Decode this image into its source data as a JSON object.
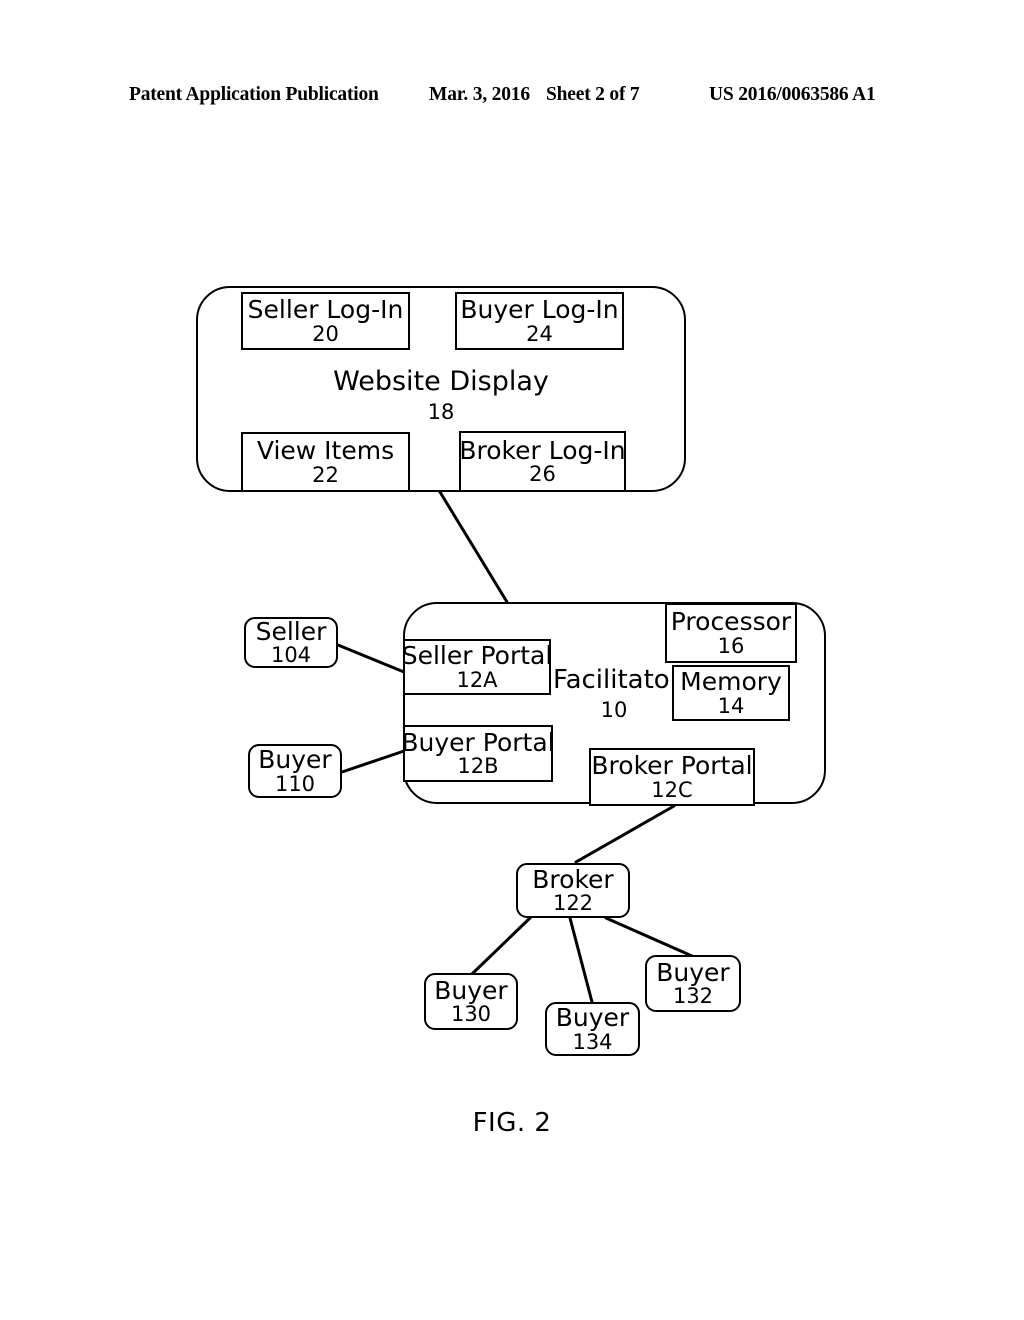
{
  "header": {
    "publication": "Patent Application Publication",
    "date": "Mar. 3, 2016",
    "sheet": "Sheet 2 of 7",
    "patent_number": "US 2016/0063586 A1"
  },
  "figure": {
    "caption": "FIG. 2",
    "website_display": {
      "label": "Website Display",
      "ref": "18",
      "children": [
        {
          "label": "Seller Log-In",
          "ref": "20"
        },
        {
          "label": "Buyer Log-In",
          "ref": "24"
        },
        {
          "label": "View Items",
          "ref": "22"
        },
        {
          "label": "Broker Log-In",
          "ref": "26"
        }
      ]
    },
    "facilitator": {
      "label": "Facilitator",
      "ref": "10",
      "children": [
        {
          "label": "Seller Portal",
          "ref": "12A"
        },
        {
          "label": "Buyer Portal",
          "ref": "12B"
        },
        {
          "label": "Broker Portal",
          "ref": "12C"
        },
        {
          "label": "Processor",
          "ref": "16"
        },
        {
          "label": "Memory",
          "ref": "14"
        }
      ]
    },
    "actors": [
      {
        "label": "Seller",
        "ref": "104"
      },
      {
        "label": "Buyer",
        "ref": "110"
      },
      {
        "label": "Broker",
        "ref": "122"
      },
      {
        "label": "Buyer",
        "ref": "130"
      },
      {
        "label": "Buyer",
        "ref": "132"
      },
      {
        "label": "Buyer",
        "ref": "134"
      }
    ],
    "connections": [
      {
        "from": "broker-log-in-26",
        "to": "facilitator-10"
      },
      {
        "from": "seller-104",
        "to": "seller-portal-12a"
      },
      {
        "from": "buyer-110",
        "to": "buyer-portal-12b"
      },
      {
        "from": "broker-portal-12c",
        "to": "broker-122"
      },
      {
        "from": "broker-122",
        "to": "buyer-130"
      },
      {
        "from": "broker-122",
        "to": "buyer-134"
      },
      {
        "from": "broker-122",
        "to": "buyer-132"
      }
    ],
    "line_color": "#000000"
  }
}
